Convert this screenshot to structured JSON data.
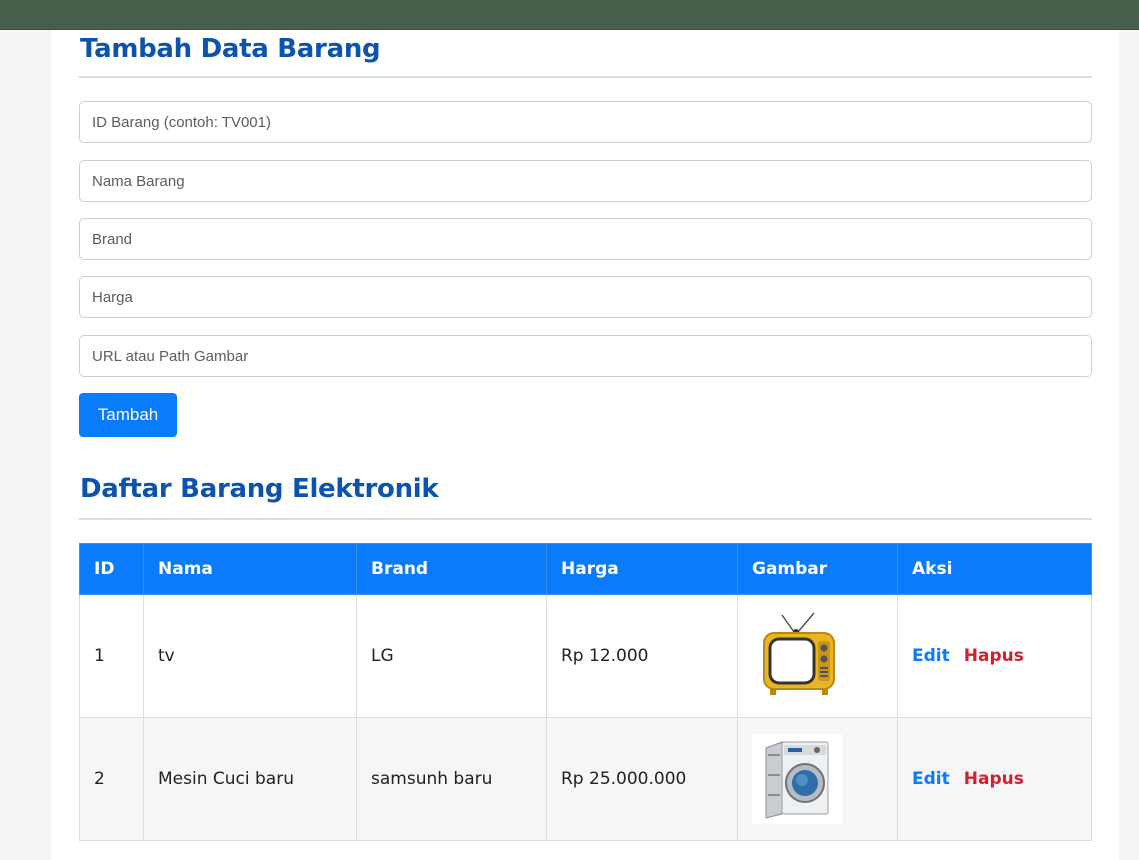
{
  "form": {
    "heading": "Tambah Data Barang",
    "fields": [
      {
        "placeholder": "ID Barang (contoh: TV001)",
        "value": ""
      },
      {
        "placeholder": "Nama Barang",
        "value": ""
      },
      {
        "placeholder": "Brand",
        "value": ""
      },
      {
        "placeholder": "Harga",
        "value": ""
      },
      {
        "placeholder": "URL atau Path Gambar",
        "value": ""
      }
    ],
    "submit_label": "Tambah"
  },
  "list": {
    "heading": "Daftar Barang Elektronik",
    "columns": [
      "ID",
      "Nama",
      "Brand",
      "Harga",
      "Gambar",
      "Aksi"
    ],
    "rows": [
      {
        "id": "1",
        "nama": "tv",
        "brand": "LG",
        "harga": "Rp 12.000",
        "gambar_icon": "retro-tv-image",
        "edit_label": "Edit",
        "delete_label": "Hapus"
      },
      {
        "id": "2",
        "nama": "Mesin Cuci baru",
        "brand": "samsunh baru",
        "harga": "Rp 25.000.000",
        "gambar_icon": "washing-machine-image",
        "edit_label": "Edit",
        "delete_label": "Hapus"
      }
    ]
  },
  "colors": {
    "heading": "#0b53ad",
    "primary": "#0a7bfb",
    "danger": "#d41f2e",
    "topbar": "#455f4b"
  }
}
